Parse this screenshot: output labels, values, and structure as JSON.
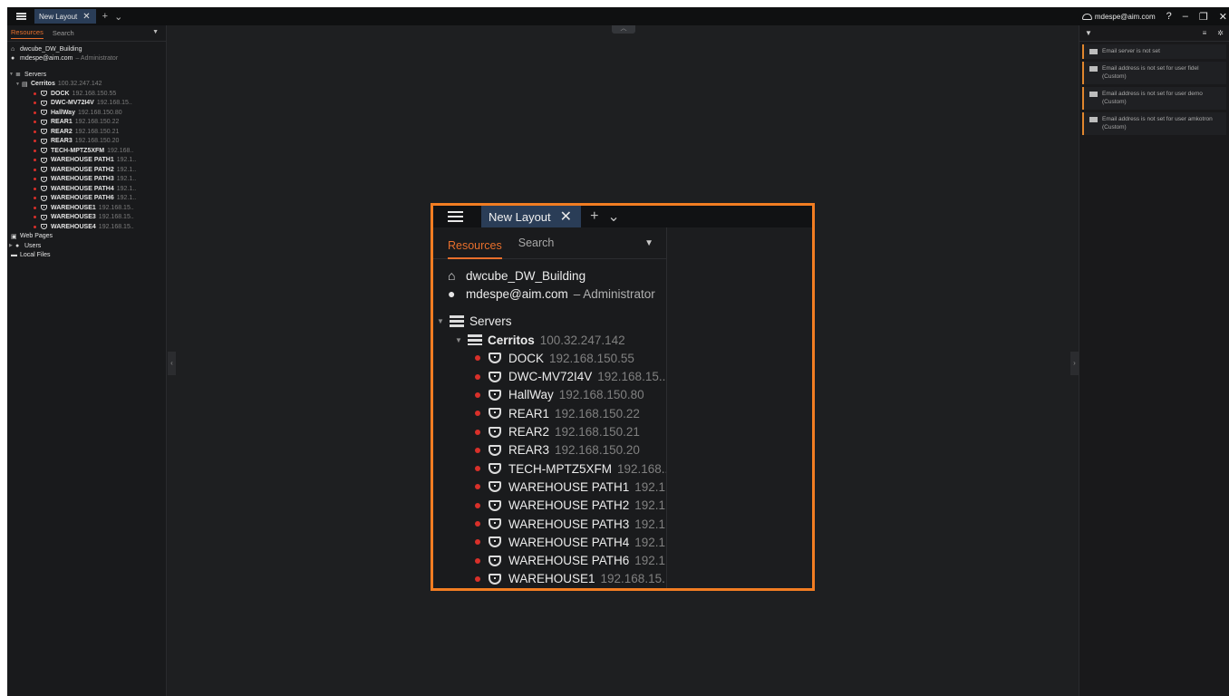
{
  "window": {
    "tab_label": "New Layout",
    "tab_close": "✕",
    "add_tab": "+",
    "tab_menu": "⌄",
    "user": "mdespe@aim.com",
    "help": "?",
    "minimize": "–",
    "restore": "❐",
    "close": "✕"
  },
  "resources_panel": {
    "tab_resources": "Resources",
    "tab_search": "Search",
    "site": "dwcube_DW_Building",
    "user_email": "mdespe@aim.com",
    "user_role": "– Administrator",
    "servers_label": "Servers",
    "server": {
      "name": "Cerritos",
      "ip": "100.32.247.142"
    },
    "cameras": [
      {
        "name": "DOCK",
        "ip": "192.168.150.55",
        "ip_short": "192.168.150.55"
      },
      {
        "name": "DWC-MV72I4V",
        "ip": "192.168.15..",
        "ip_short": "192.168.15.."
      },
      {
        "name": "HallWay",
        "ip": "192.168.150.80",
        "ip_short": "192.168.150.80"
      },
      {
        "name": "REAR1",
        "ip": "192.168.150.22",
        "ip_short": "192.168.150.22"
      },
      {
        "name": "REAR2",
        "ip": "192.168.150.21",
        "ip_short": "192.168.150.21"
      },
      {
        "name": "REAR3",
        "ip": "192.168.150.20",
        "ip_short": "192.168.150.20"
      },
      {
        "name": "TECH-MPTZ5XFM",
        "ip": "192.168..",
        "ip_short": "192.168.."
      },
      {
        "name": "WAREHOUSE PATH1",
        "ip": "192.1..",
        "ip_short": "192.1.."
      },
      {
        "name": "WAREHOUSE PATH2",
        "ip": "192.1..",
        "ip_short": "192.1.."
      },
      {
        "name": "WAREHOUSE PATH3",
        "ip": "192.1..",
        "ip_short": "192.1.."
      },
      {
        "name": "WAREHOUSE PATH4",
        "ip": "192.1..",
        "ip_short": "192.1.."
      },
      {
        "name": "WAREHOUSE PATH6",
        "ip": "192.1..",
        "ip_short": "192.1.."
      },
      {
        "name": "WAREHOUSE1",
        "ip": "192.168.15..",
        "ip_short": "192.168.15.."
      },
      {
        "name": "WAREHOUSE3",
        "ip": "192.168.15..",
        "ip_short": "192.168.15.."
      },
      {
        "name": "WAREHOUSE4",
        "ip": "192.168.15..",
        "ip_short": "192.168.15.."
      }
    ],
    "web_pages": "Web Pages",
    "users": "Users",
    "local_files": "Local Files"
  },
  "notifications": [
    {
      "text": "Email server is not set"
    },
    {
      "text": "Email address is not set for user fidel (Custom)"
    },
    {
      "text": "Email address is not set for user demo (Custom)"
    },
    {
      "text": "Email address is not set for user amkotron (Custom)"
    }
  ],
  "colors": {
    "accent": "#e86f2c",
    "highlight_border": "#f27d22",
    "offline_dot": "#d9302a",
    "tab_bg": "#2a3d57"
  }
}
